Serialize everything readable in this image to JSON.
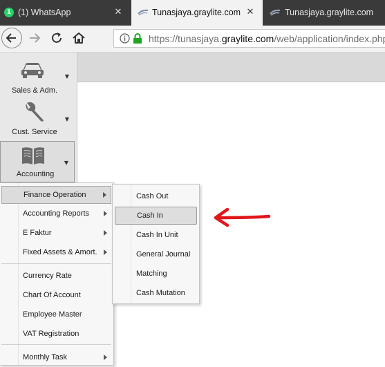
{
  "tabs": [
    {
      "title": "(1) WhatsApp",
      "badge": "1",
      "icon": "whatsapp-icon",
      "active": false
    },
    {
      "title": "Tunasjaya.graylite.com",
      "icon": "graylite-icon",
      "active": true
    },
    {
      "title": "Tunasjaya.graylite.com",
      "icon": "graylite-icon",
      "active": false
    }
  ],
  "close_glyph": "✕",
  "address_bar": {
    "prefix": "https://tunasjaya.",
    "domain": "graylite.com",
    "path": "/web/application/index.php"
  },
  "modules": [
    {
      "label": "Sales & Adm.",
      "icon": "car-icon"
    },
    {
      "label": "Cust. Service",
      "icon": "wrench-icon"
    },
    {
      "label": "Accounting",
      "icon": "book-icon",
      "active": true
    }
  ],
  "caret_glyph": "▼",
  "accounting_menu": [
    {
      "label": "Finance Operation",
      "submenu": true,
      "active": true
    },
    {
      "label": "Accounting Reports",
      "submenu": true
    },
    {
      "label": "E Faktur",
      "submenu": true
    },
    {
      "label": "Fixed Assets & Amort.",
      "submenu": true
    },
    {
      "label": "Currency Rate"
    },
    {
      "label": "Chart Of Account"
    },
    {
      "label": "Employee Master"
    },
    {
      "label": "VAT Registration"
    },
    {
      "label": "Monthly Task",
      "submenu": true
    }
  ],
  "finance_operation_menu": [
    {
      "label": "Cash Out"
    },
    {
      "label": "Cash In",
      "active": true
    },
    {
      "label": "Cash In Unit"
    },
    {
      "label": "General Journal"
    },
    {
      "label": "Matching"
    },
    {
      "label": "Cash Mutation"
    }
  ],
  "colors": {
    "annotation_arrow": "#e0161b",
    "lock": "#1fa51f",
    "whatsapp": "#25d366"
  }
}
